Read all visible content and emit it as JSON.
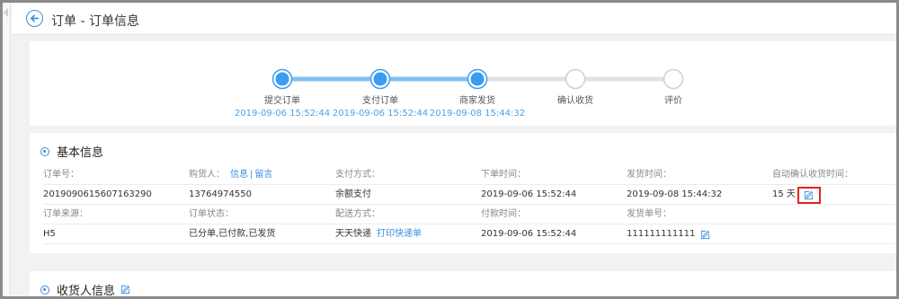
{
  "header": {
    "title": "订单 - 订单信息"
  },
  "progress": {
    "steps": [
      {
        "label": "提交订单",
        "time": "2019-09-06 15:52:44",
        "done": true
      },
      {
        "label": "支付订单",
        "time": "2019-09-06 15:52:44",
        "done": true
      },
      {
        "label": "商家发货",
        "time": "2019-09-08 15:44:32",
        "done": true
      },
      {
        "label": "确认收货",
        "time": "",
        "done": false
      },
      {
        "label": "评价",
        "time": "",
        "done": false
      }
    ],
    "colors": {
      "done": "#3b9cf0",
      "pending": "#cfcfcf",
      "line_done": "#7fc3f5"
    }
  },
  "basic": {
    "title": "基本信息",
    "row1": {
      "order_no_label": "订单号：",
      "buyer_label": "购货人：",
      "buyer_info_link": "信息",
      "buyer_sep": "|",
      "buyer_msg_link": "留言",
      "pay_method_label": "支付方式：",
      "order_time_label": "下单时间：",
      "ship_time_label": "发货时间：",
      "auto_confirm_label": "自动确认收货时间："
    },
    "row2": {
      "order_no": "2019090615607163290",
      "buyer": "13764974550",
      "pay_method": "余额支付",
      "order_time": "2019-09-06 15:52:44",
      "ship_time": "2019-09-08 15:44:32",
      "auto_confirm": "15 天"
    },
    "row3": {
      "source_label": "订单来源：",
      "status_label": "订单状态：",
      "delivery_label": "配送方式：",
      "pay_time_label": "付款时间：",
      "ship_no_label": "发货单号："
    },
    "row4": {
      "source": "H5",
      "status": "已分单,已付款,已发货",
      "delivery": "天天快递",
      "print_link": "打印快递单",
      "pay_time": "2019-09-06 15:52:44",
      "ship_no": "111111111111"
    }
  },
  "receiver": {
    "title": "收货人信息"
  }
}
